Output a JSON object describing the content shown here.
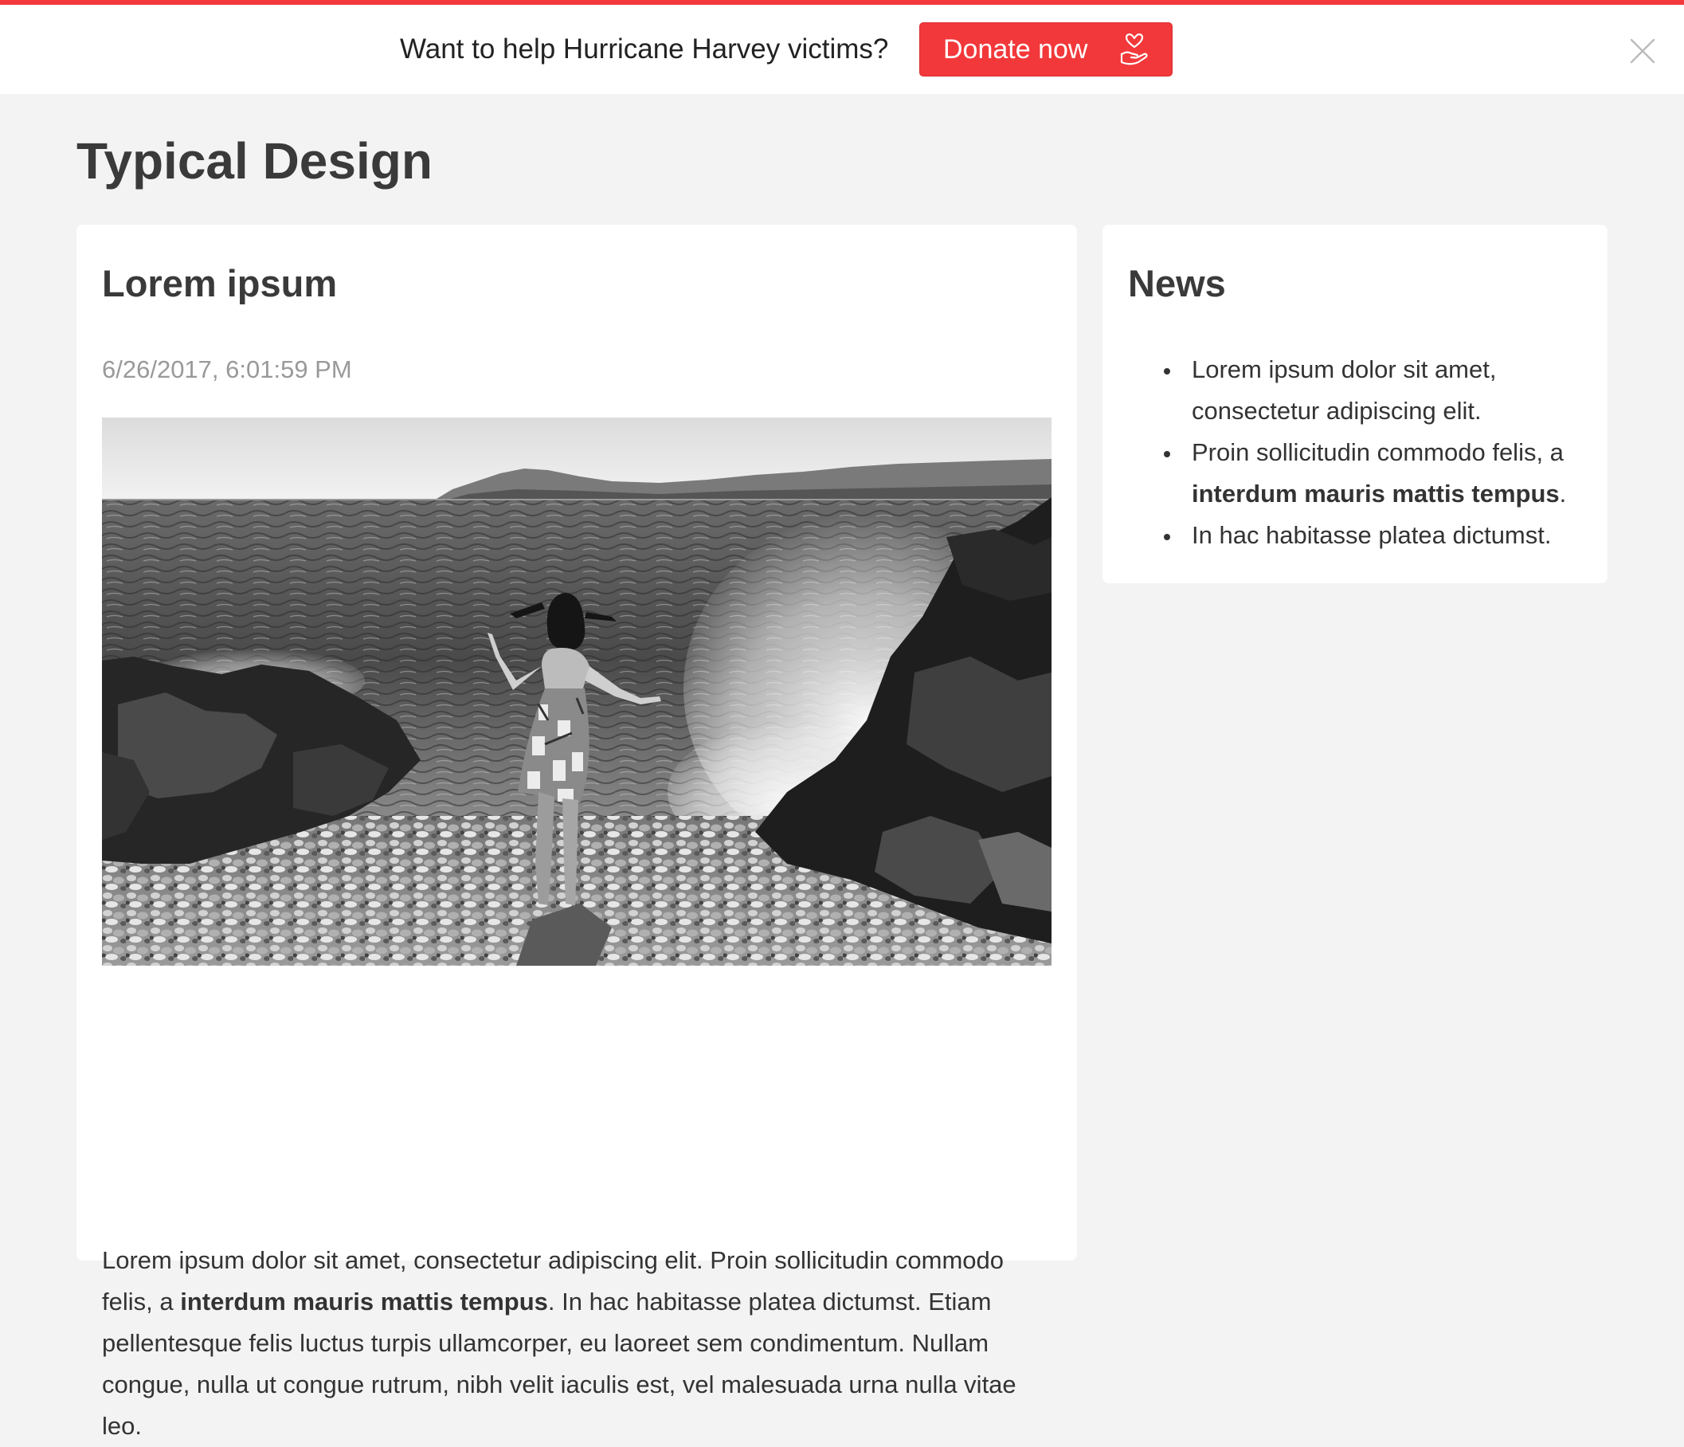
{
  "banner": {
    "message": "Want to help Hurricane Harvey victims?",
    "donate_label": "Donate now",
    "donate_icon": "heart-in-hand-icon",
    "close_icon": "close-icon",
    "accent_color": "#f2383a"
  },
  "page": {
    "title": "Typical Design"
  },
  "article": {
    "heading": "Lorem ipsum",
    "date": "6/26/2017, 6:01:59 PM",
    "image_alt": "Black and white photo of a woman in a dress stepping onto a rocky pebble beach as waves crash against the rocks, with a hillside town across the water",
    "body_part1": "Lorem ipsum dolor sit amet, consectetur adipiscing elit. Proin sollicitudin commodo felis, a ",
    "body_bold": "interdum mauris mattis tempus",
    "body_part2": ". In hac habitasse platea dictumst. Etiam pellentesque felis luctus turpis ullamcorper, eu laoreet sem condimentum. Nullam congue, nulla ut congue rutrum, nibh velit iaculis est, vel malesuada urna nulla vitae leo."
  },
  "news": {
    "heading": "News",
    "items": [
      {
        "text": "Lorem ipsum dolor sit amet, consectetur adipiscing elit."
      },
      {
        "text_before": "Proin sollicitudin commodo felis, a ",
        "bold": "interdum mauris mattis tempus",
        "text_after": "."
      },
      {
        "text": "In hac habitasse platea dictumst."
      }
    ]
  }
}
